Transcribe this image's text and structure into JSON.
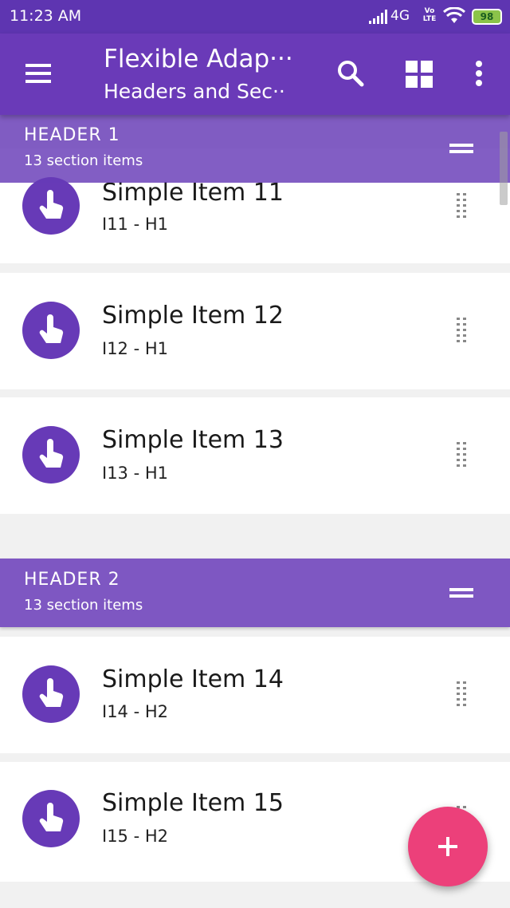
{
  "status_bar": {
    "time": "11:23 AM",
    "network": "4G",
    "volte": "Vo LTE",
    "battery": "98"
  },
  "toolbar": {
    "title": "Flexible Adap···",
    "subtitle": "Headers and Sec··",
    "icons": [
      "menu-icon",
      "search-icon",
      "grid-view-icon",
      "more-vert-icon"
    ]
  },
  "colors": {
    "primary": "#6a3ab8",
    "accent": "#ec407a",
    "header": "#7e57c2"
  },
  "sections": [
    {
      "title": "HEADER 1",
      "subtitle": "13 section items",
      "items": [
        {
          "title": "Simple Item 11",
          "subtitle": "I11 - H1"
        },
        {
          "title": "Simple Item 12",
          "subtitle": "I12 - H1"
        },
        {
          "title": "Simple Item 13",
          "subtitle": "I13 - H1"
        }
      ]
    },
    {
      "title": "HEADER 2",
      "subtitle": "13 section items",
      "items": [
        {
          "title": "Simple Item 14",
          "subtitle": "I14 - H2"
        },
        {
          "title": "Simple Item 15",
          "subtitle": "I15 - H2"
        }
      ]
    }
  ],
  "fab": {
    "label": "+",
    "icon": "add-icon"
  }
}
